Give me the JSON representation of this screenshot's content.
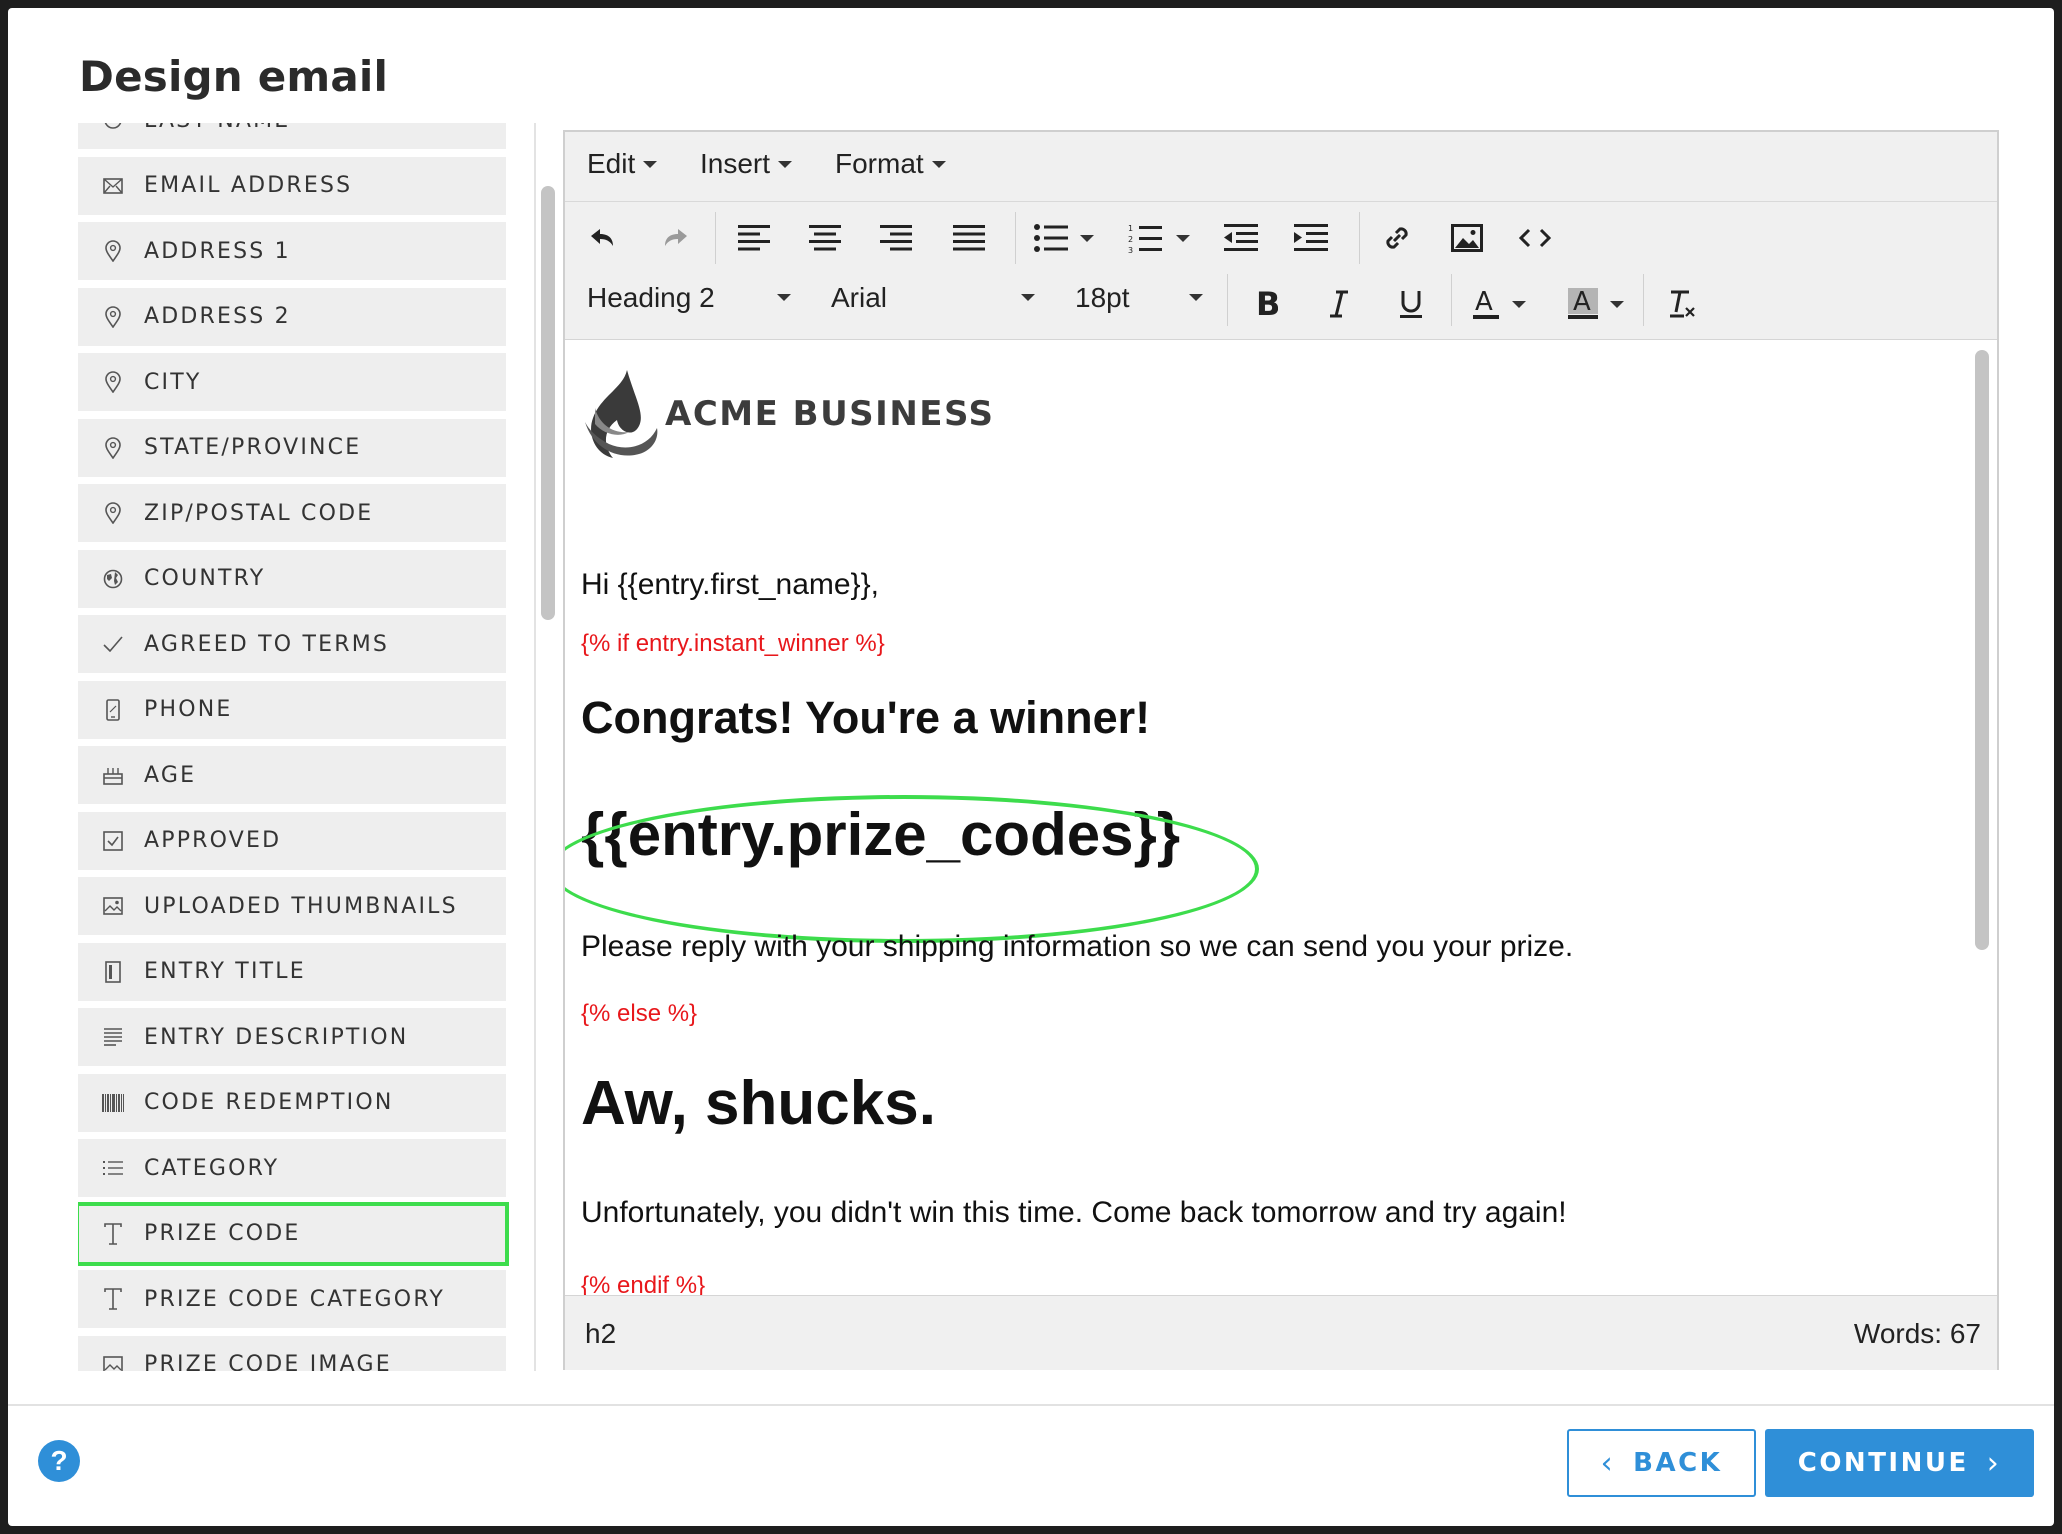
{
  "dialog": {
    "title": "Design email"
  },
  "fields": [
    {
      "label": "LAST NAME",
      "icon": "user-icon"
    },
    {
      "label": "EMAIL ADDRESS",
      "icon": "envelope-icon"
    },
    {
      "label": "ADDRESS 1",
      "icon": "map-pin-icon"
    },
    {
      "label": "ADDRESS 2",
      "icon": "map-pin-icon"
    },
    {
      "label": "CITY",
      "icon": "map-pin-icon"
    },
    {
      "label": "STATE/PROVINCE",
      "icon": "map-pin-icon"
    },
    {
      "label": "ZIP/POSTAL CODE",
      "icon": "map-pin-icon"
    },
    {
      "label": "COUNTRY",
      "icon": "globe-icon"
    },
    {
      "label": "AGREED TO TERMS",
      "icon": "check-icon"
    },
    {
      "label": "PHONE",
      "icon": "phone-icon"
    },
    {
      "label": "AGE",
      "icon": "cake-icon"
    },
    {
      "label": "APPROVED",
      "icon": "checkbox-icon"
    },
    {
      "label": "UPLOADED THUMBNAILS",
      "icon": "image-icon"
    },
    {
      "label": "ENTRY TITLE",
      "icon": "document-icon"
    },
    {
      "label": "ENTRY DESCRIPTION",
      "icon": "paragraph-icon"
    },
    {
      "label": "CODE REDEMPTION",
      "icon": "barcode-icon"
    },
    {
      "label": "CATEGORY",
      "icon": "list-icon"
    },
    {
      "label": "PRIZE CODE",
      "icon": "text-icon"
    },
    {
      "label": "PRIZE CODE CATEGORY",
      "icon": "text-icon"
    },
    {
      "label": "PRIZE CODE IMAGE",
      "icon": "image-icon"
    }
  ],
  "editor": {
    "menus": {
      "edit": "Edit",
      "insert": "Insert",
      "format": "Format"
    },
    "block_format": "Heading 2",
    "font_family": "Arial",
    "font_size": "18pt",
    "status_path": "h2",
    "word_count": "Words: 67"
  },
  "email": {
    "logo_text": "ACME BUSINESS",
    "greeting": "Hi {{entry.first_name}},",
    "if_tag": "{% if entry.instant_winner %}",
    "winner_heading": "Congrats! You're a winner!",
    "prize_code_var": "{{entry.prize_codes}}",
    "winner_body": "Please reply with your shipping information so we can send you your prize.",
    "else_tag": "{% else %}",
    "loser_heading": "Aw, shucks.",
    "loser_body": "Unfortunately, you didn't win this time. Come back tomorrow and try again!",
    "endif_tag": "{% endif %}"
  },
  "footer": {
    "help": "?",
    "back_label": "BACK",
    "continue_label": "CONTINUE"
  },
  "colors": {
    "accent": "#2f8fd8",
    "highlight": "#3ddc4c",
    "template_tag": "#e8171b"
  }
}
